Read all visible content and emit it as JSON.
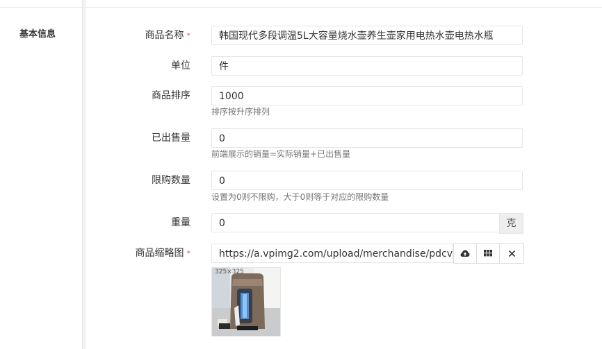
{
  "section": {
    "title": "基本信息"
  },
  "fields": {
    "name": {
      "label": "商品名称",
      "required_mark": "*",
      "value": "韩国现代多段调温5L大容量烧水壶养生壶家用电热水壶电热水瓶"
    },
    "unit": {
      "label": "单位",
      "value": "件"
    },
    "sort": {
      "label": "商品排序",
      "value": "1000",
      "help": "排序按升序排列"
    },
    "sold": {
      "label": "已出售量",
      "value": "0",
      "help": "前端展示的销量=实际销量+已出售量"
    },
    "limit": {
      "label": "限购数量",
      "value": "0",
      "help": "设置为0则不限购，大于0则等于对应的限购数量"
    },
    "weight": {
      "label": "重量",
      "value": "0",
      "addon": "克"
    },
    "thumbnail": {
      "label": "商品缩略图",
      "required_mark": "*",
      "value": "https://a.vpimg2.com/upload/merchandise/pdcvis/605",
      "size_label": "325×325",
      "buttons": [
        "cloud-upload-icon",
        "grid-icon",
        "close-icon"
      ]
    }
  },
  "colors": {
    "required": "#ed5565",
    "border": "#e5e6e7",
    "help_text": "#737373"
  }
}
